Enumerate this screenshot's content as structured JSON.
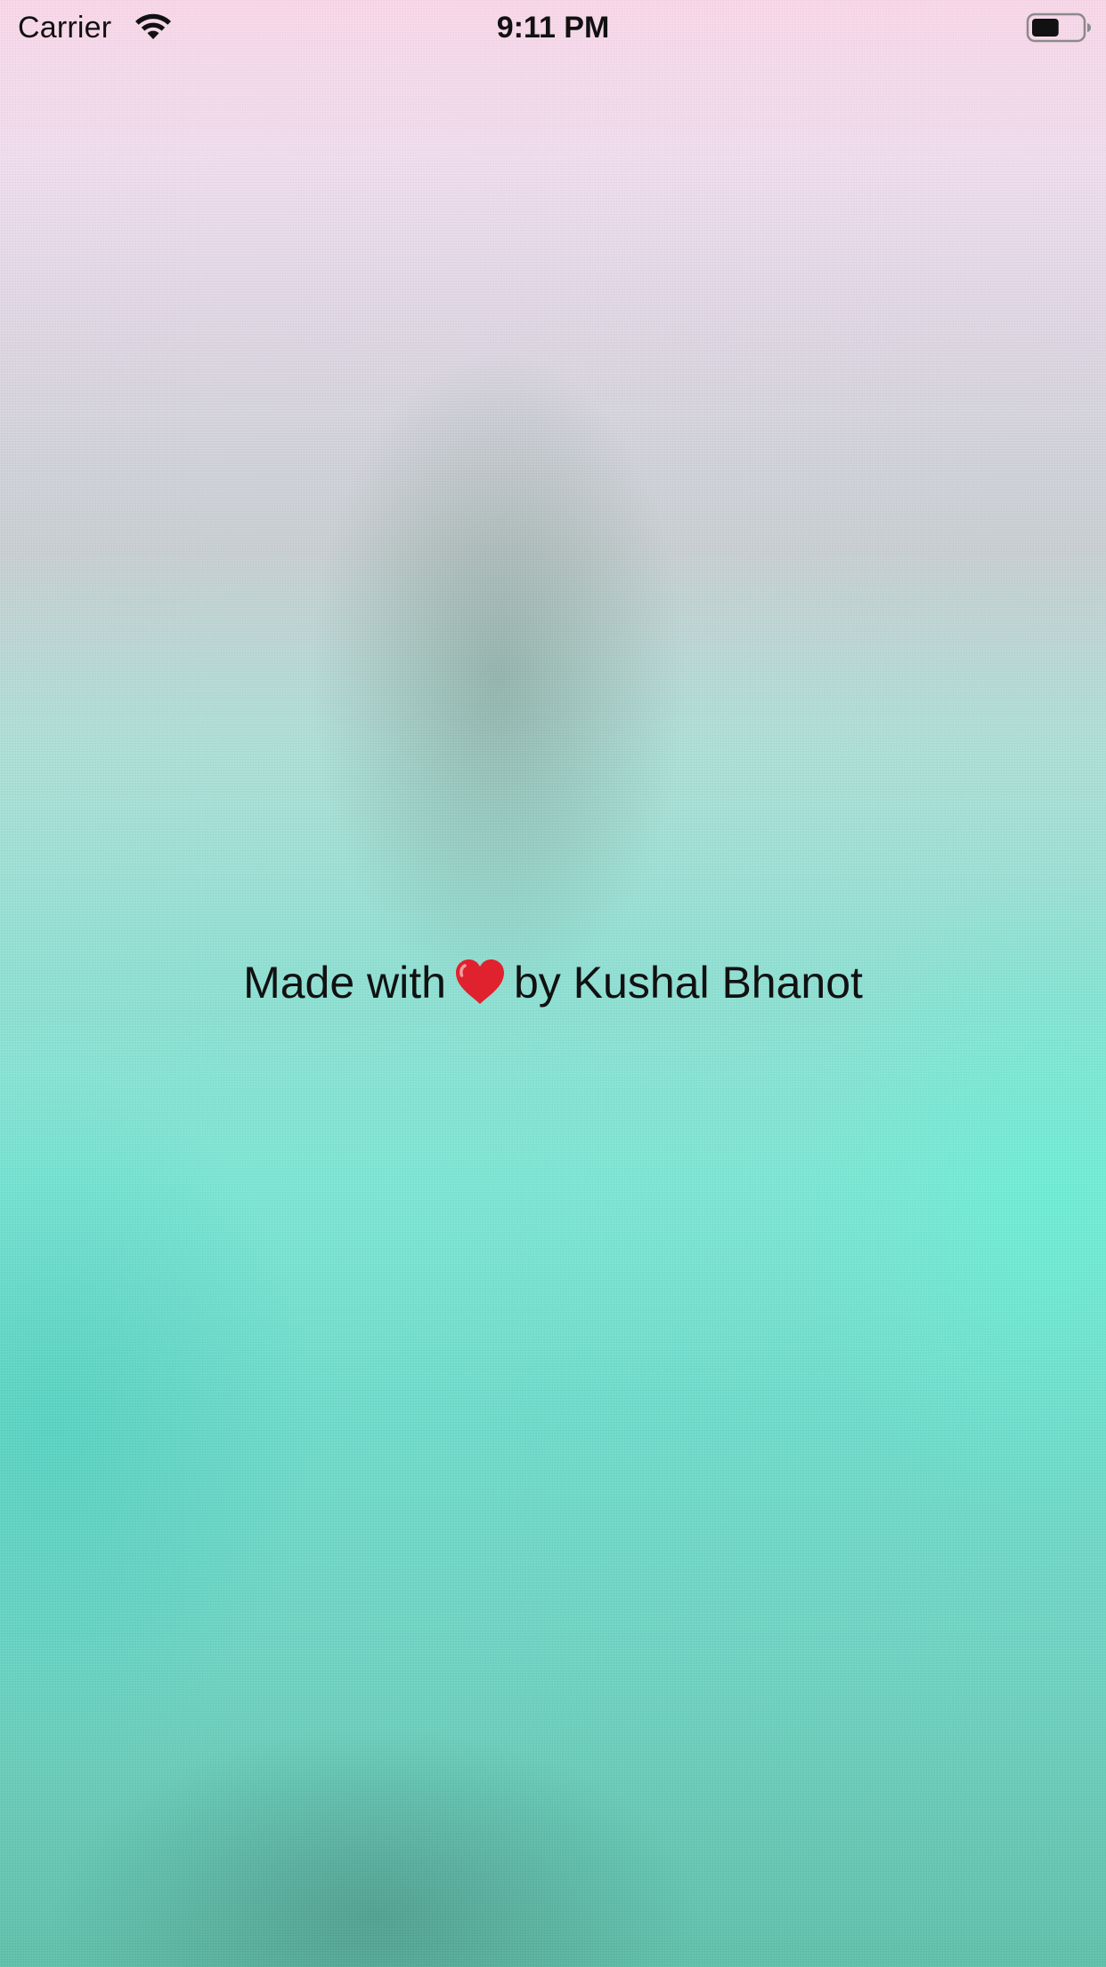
{
  "status_bar": {
    "carrier": "Carrier",
    "time": "9:11 PM",
    "wifi_icon": "wifi-icon",
    "battery_icon": "battery-icon",
    "battery_level": 0.55
  },
  "main": {
    "credit_prefix": "Made with",
    "heart_icon": "heart-icon",
    "credit_suffix": "by Kushal Bhanot"
  },
  "colors": {
    "top": "#fbd9ea",
    "middle": "#8fe1d4",
    "bottom": "#5fc1ab",
    "heart": "#e0222e",
    "text": "#111111"
  }
}
